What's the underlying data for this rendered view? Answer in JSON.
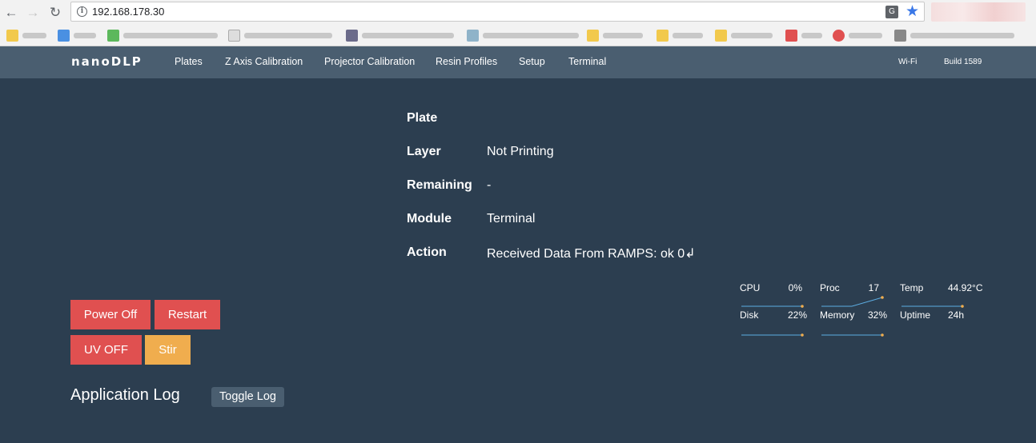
{
  "browser": {
    "url": "192.168.178.30",
    "back_icon": "←",
    "forward_icon": "→",
    "reload_icon": "↻",
    "translate_icon": "G",
    "star_icon": "★"
  },
  "nav": {
    "brand": "nanoDLP",
    "links": [
      "Plates",
      "Z Axis Calibration",
      "Projector Calibration",
      "Resin Profiles",
      "Setup",
      "Terminal"
    ],
    "wifi": "Wi-Fi",
    "build": "Build 1589"
  },
  "status": {
    "plate_label": "Plate",
    "plate_value": "",
    "layer_label": "Layer",
    "layer_value": "Not Printing",
    "remaining_label": "Remaining",
    "remaining_value": "-",
    "module_label": "Module",
    "module_value": "Terminal",
    "action_label": "Action",
    "action_value": "Received Data From RAMPS: ok 0↲"
  },
  "stats": {
    "cpu_label": "CPU",
    "cpu_value": "0%",
    "proc_label": "Proc",
    "proc_value": "17",
    "temp_label": "Temp",
    "temp_value": "44.92°C",
    "disk_label": "Disk",
    "disk_value": "22%",
    "memory_label": "Memory",
    "memory_value": "32%",
    "uptime_label": "Uptime",
    "uptime_value": "24h"
  },
  "buttons": {
    "power_off": "Power Off",
    "restart": "Restart",
    "uv_off": "UV OFF",
    "stir": "Stir"
  },
  "log": {
    "title": "Application Log",
    "toggle": "Toggle Log"
  },
  "colors": {
    "page_bg": "#2c3e50",
    "nav_bg": "#4a5e70",
    "danger": "#e05050",
    "warning": "#f0ad4e",
    "spark_line": "#5dade2",
    "spark_dot": "#f0ad4e"
  }
}
